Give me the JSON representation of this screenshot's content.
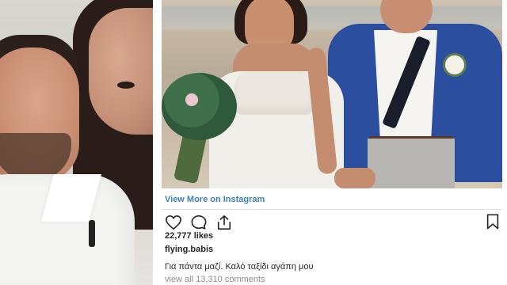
{
  "post": {
    "view_more_label": "View More on Instagram",
    "likes": "22,777 likes",
    "username": "flying.babis",
    "caption": "Για πάντα μαζί. Καλό ταξίδι αγάπη μου",
    "comments_link": "view all 13,310 comments"
  },
  "actions": {
    "icons": [
      "heart-icon",
      "comment-icon",
      "share-icon",
      "bookmark-icon"
    ]
  },
  "colors": {
    "link_blue": "#3b7fc4",
    "text_dark": "#262626",
    "text_muted": "#8e8e8e",
    "jacket_blue": "#2c4e9e"
  }
}
